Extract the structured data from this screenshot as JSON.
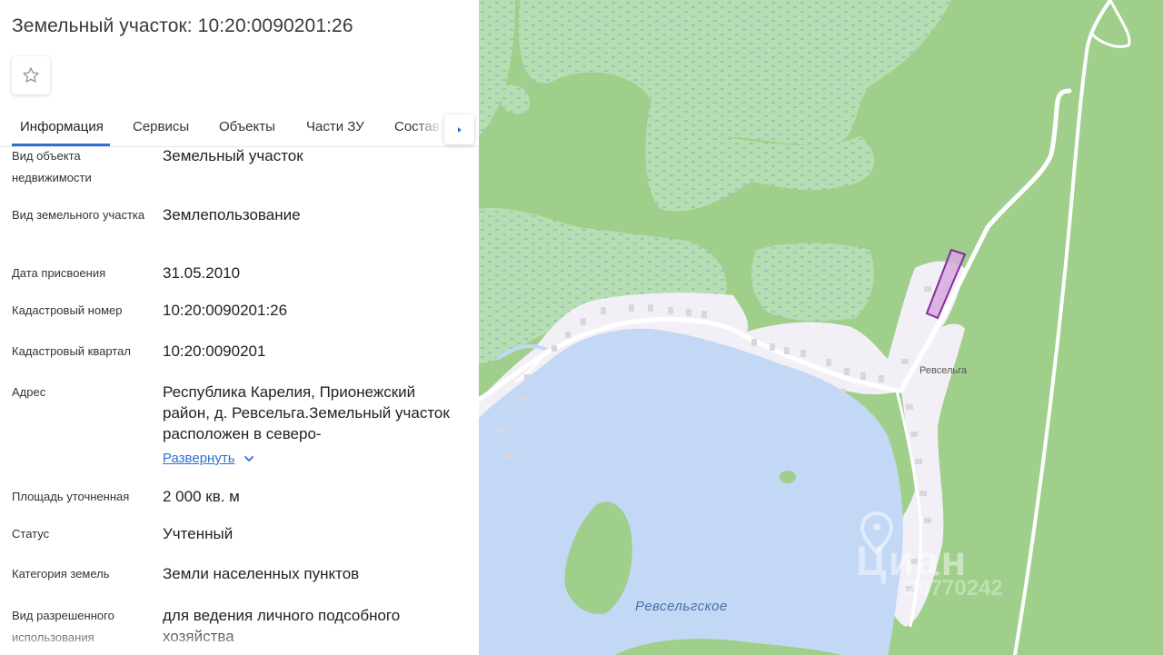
{
  "header": {
    "title": "Земельный участок: 10:20:0090201:26"
  },
  "tabs": [
    {
      "label": "Информация",
      "active": true
    },
    {
      "label": "Сервисы",
      "active": false
    },
    {
      "label": "Объекты",
      "active": false
    },
    {
      "label": "Части ЗУ",
      "active": false
    },
    {
      "label": "Состав",
      "active": false
    }
  ],
  "info": {
    "object_type_label": "Вид объекта недвижимости",
    "object_type_value": "Земельный участок",
    "plot_type_label": "Вид земельного участка",
    "plot_type_value": "Землепользование",
    "assign_date_label": "Дата присвоения",
    "assign_date_value": "31.05.2010",
    "cadastral_number_label": "Кадастровый номер",
    "cadastral_number_value": "10:20:0090201:26",
    "cadastral_quarter_label": "Кадастровый квартал",
    "cadastral_quarter_value": "10:20:0090201",
    "address_label": "Адрес",
    "address_value": "Республика Карелия, Прионежский район, д. Ревсельга.Земельный участок расположен в северо-",
    "expand_label": "Развернуть",
    "area_label": "Площадь уточненная",
    "area_value": "2 000 кв. м",
    "status_label": "Статус",
    "status_value": "Учтенный",
    "land_category_label": "Категория земель",
    "land_category_value": "Земли населенных пунктов",
    "permitted_use_label": "Вид разрешенного использования",
    "permitted_use_value": "для ведения личного подсобного хозяйства"
  },
  "map": {
    "village_label": "Ревсельга",
    "lake_label": "Ревсельгское",
    "watermark": "Циан",
    "watermark_id": "28770242",
    "colors": {
      "forest": "#9fcf8a",
      "swamp": "#b7deb0",
      "water": "#c3d8f5",
      "settlement": "#f2f0f6",
      "road": "#ffffff",
      "parcel_stroke": "#8a2a9a",
      "parcel_fill": "#d7a9e0"
    }
  },
  "icons": {
    "favorite": "star-outline-icon",
    "tabs_next": "triangle-right-icon",
    "expand": "chevron-down-icon"
  }
}
